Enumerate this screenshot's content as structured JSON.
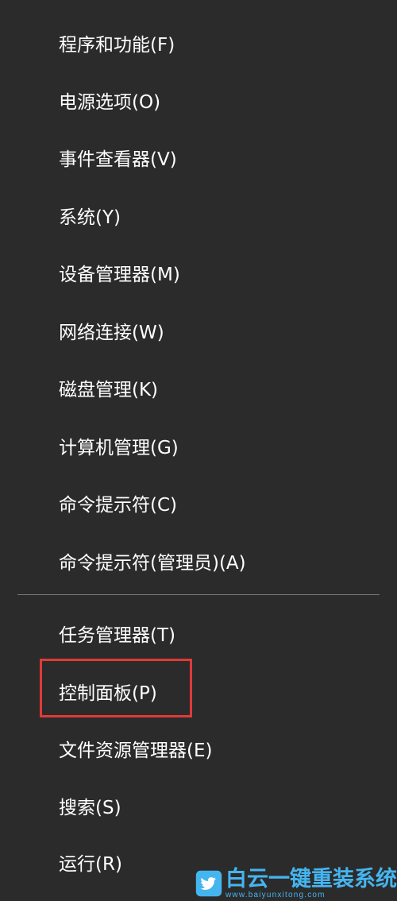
{
  "menu": {
    "group1": [
      {
        "label": "程序和功能(F)"
      },
      {
        "label": "电源选项(O)"
      },
      {
        "label": "事件查看器(V)"
      },
      {
        "label": "系统(Y)"
      },
      {
        "label": "设备管理器(M)"
      },
      {
        "label": "网络连接(W)"
      },
      {
        "label": "磁盘管理(K)"
      },
      {
        "label": "计算机管理(G)"
      },
      {
        "label": "命令提示符(C)"
      },
      {
        "label": "命令提示符(管理员)(A)"
      }
    ],
    "group2": [
      {
        "label": "任务管理器(T)"
      },
      {
        "label": "控制面板(P)"
      },
      {
        "label": "文件资源管理器(E)"
      },
      {
        "label": "搜索(S)"
      },
      {
        "label": "运行(R)"
      }
    ],
    "highlighted_item": "控制面板(P)",
    "highlight_color": "#e03a3a"
  },
  "watermark": {
    "logo_icon": "twitter-bird-icon",
    "name": "白云一键重装系统",
    "url": "www.baiyunxitong.com",
    "color": "#45b5f0"
  },
  "colors": {
    "background": "#2b2b2b",
    "text": "#ffffff",
    "separator": "#7a7a7a"
  }
}
